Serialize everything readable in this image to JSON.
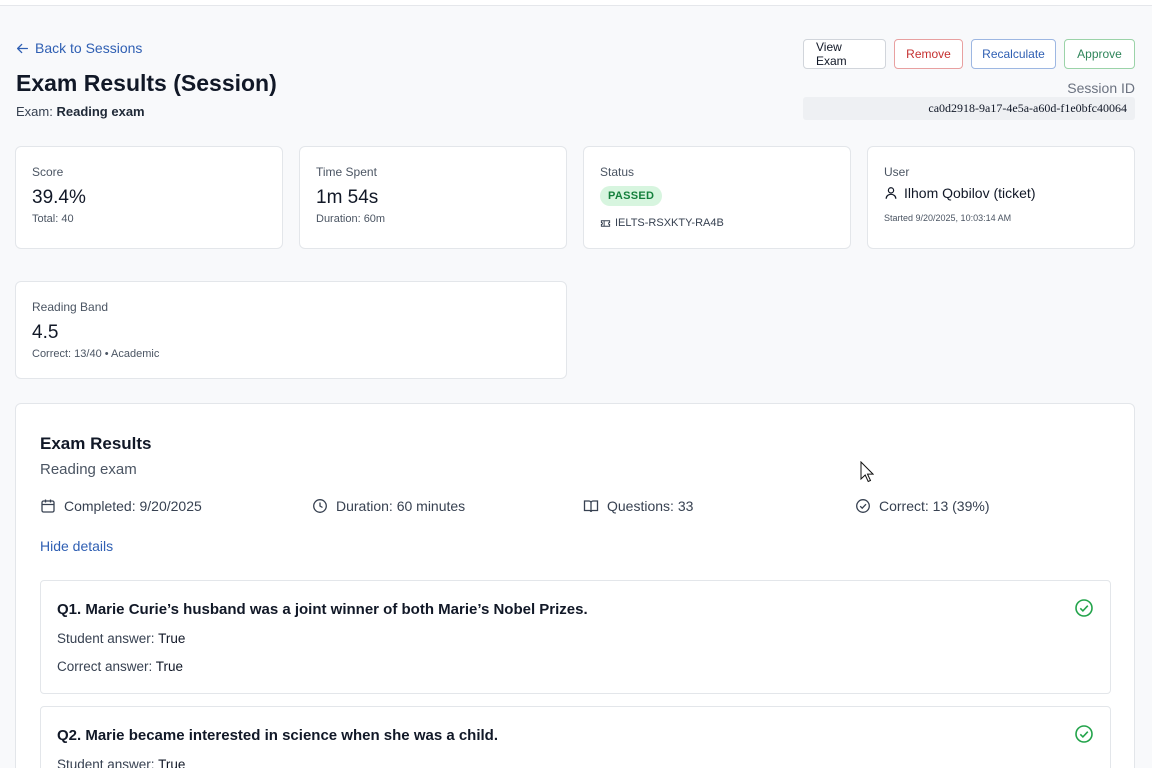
{
  "header": {
    "back_label": "Back to Sessions",
    "title": "Exam Results (Session)",
    "exam_prefix": "Exam:",
    "exam_name": "Reading exam",
    "session_label": "Session ID",
    "session_id": "ca0d2918-9a17-4e5a-a60d-f1e0bfc40064"
  },
  "actions": {
    "view_exam": "View Exam",
    "remove": "Remove",
    "recalculate": "Recalculate",
    "approve": "Approve"
  },
  "cards": {
    "score": {
      "label": "Score",
      "value": "39.4%",
      "sub": "Total: 40"
    },
    "time": {
      "label": "Time Spent",
      "value": "1m 54s",
      "sub": "Duration: 60m"
    },
    "status": {
      "label": "Status",
      "badge": "PASSED",
      "ticket": "IELTS-RSXKTY-RA4B"
    },
    "user": {
      "label": "User",
      "name": "Ilhom Qobilov (ticket)",
      "started": "Started 9/20/2025, 10:03:14 AM"
    },
    "band": {
      "label": "Reading Band",
      "value": "4.5",
      "sub": "Correct: 13/40 • Academic"
    }
  },
  "results": {
    "title": "Exam Results",
    "subtitle": "Reading exam",
    "completed": "Completed: 9/20/2025",
    "duration": "Duration: 60 minutes",
    "questions": "Questions: 33",
    "correct": "Correct: 13 (39%)",
    "toggle_label": "Hide details",
    "student_label": "Student answer:",
    "correct_label": "Correct answer:",
    "items": [
      {
        "q": "Q1. Marie Curie’s husband was a joint winner of both Marie’s Nobel Prizes.",
        "student": "True",
        "answer": "True"
      },
      {
        "q": "Q2. Marie became interested in science when she was a child.",
        "student": "True",
        "answer": ""
      }
    ]
  },
  "colors": {
    "link": "#2f5fb3",
    "danger": "#c53030",
    "success": "#2f855a",
    "badge_bg": "#d7f5df",
    "check": "#22a34a"
  },
  "icons": [
    "arrow-left-icon",
    "ticket-icon",
    "user-icon",
    "calendar-icon",
    "clock-icon",
    "book-open-icon",
    "check-circle-icon",
    "cursor-icon"
  ]
}
